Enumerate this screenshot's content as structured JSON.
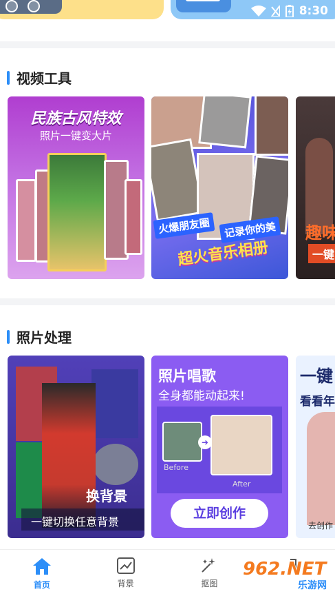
{
  "status_bar": {
    "time": "8:30"
  },
  "sections": {
    "video_tools": {
      "title": "视频工具"
    },
    "photo_processing": {
      "title": "照片处理"
    }
  },
  "video_cards": {
    "ethnic": {
      "title": "民族古风特效",
      "subtitle": "照片一键变大片"
    },
    "music_album": {
      "tag1": "火爆朋友圈",
      "tag2": "记录你的美",
      "title": "超火音乐相册"
    },
    "third": {
      "title": "趣味",
      "subtitle": "一键"
    }
  },
  "photo_cards": {
    "bg_change": {
      "title": "换背景",
      "subtitle": "一键切换任意背景"
    },
    "sing": {
      "title": "照片唱歌",
      "subtitle": "全身都能动起来!",
      "before": "Before",
      "after": "After",
      "cta": "立即创作"
    },
    "third": {
      "title": "一键",
      "subtitle": "看看年",
      "cta": "去创作"
    }
  },
  "nav": {
    "items": [
      {
        "label": "首页",
        "icon": "home-icon"
      },
      {
        "label": "背景",
        "icon": "background-icon"
      },
      {
        "label": "抠图",
        "icon": "cutout-icon"
      },
      {
        "label": "",
        "icon": "more-icon"
      }
    ]
  },
  "watermark": {
    "brand": "962.NET",
    "sub": "乐游网"
  },
  "colors": {
    "accent": "#2c8ef8",
    "section_bar": "#2c8ef8",
    "nav_active": "#2c8ef8"
  }
}
